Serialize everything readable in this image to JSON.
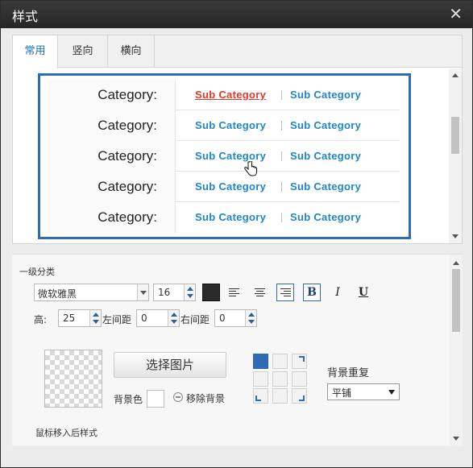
{
  "window": {
    "title": "样式",
    "close_glyph": "✕"
  },
  "tabs": [
    {
      "label": "常用",
      "active": true
    },
    {
      "label": "竖向",
      "active": false
    },
    {
      "label": "横向",
      "active": false
    }
  ],
  "preview": {
    "rows": [
      {
        "category": "Category:",
        "sub1": "Sub Category",
        "sub2": "Sub Category",
        "sub1_hover": true
      },
      {
        "category": "Category:",
        "sub1": "Sub Category",
        "sub2": "Sub Category",
        "sub1_hover": false
      },
      {
        "category": "Category:",
        "sub1": "Sub Category",
        "sub2": "Sub Category",
        "sub1_hover": false
      },
      {
        "category": "Category:",
        "sub1": "Sub Category",
        "sub2": "Sub Category",
        "sub1_hover": false
      },
      {
        "category": "Category:",
        "sub1": "Sub Category",
        "sub2": "Sub Category",
        "sub1_hover": false
      }
    ],
    "colors": {
      "border": "#2f6ab5",
      "link": "#1f86c6",
      "link_hover": "#e2392b"
    }
  },
  "settings": {
    "section_title": "一级分类",
    "font_family": "微软雅黑",
    "font_size": "16",
    "text_color": "#2b2b2b",
    "toolbar": {
      "bold": "B",
      "italic": "I",
      "underline": "U",
      "active_align": "right"
    },
    "height_label": "高:",
    "height_value": "25",
    "padding_left_label": "左间距",
    "padding_left_value": "0",
    "padding_right_label": "右间距",
    "padding_right_value": "0",
    "choose_image_label": "选择图片",
    "bgcolor_label": "背景色",
    "remove_bg_label": "移除背景",
    "repeat_label": "背景重复",
    "repeat_value": "平铺",
    "bg_position_selected": "top-left",
    "hover_section_title": "鼠标移入后样式"
  }
}
